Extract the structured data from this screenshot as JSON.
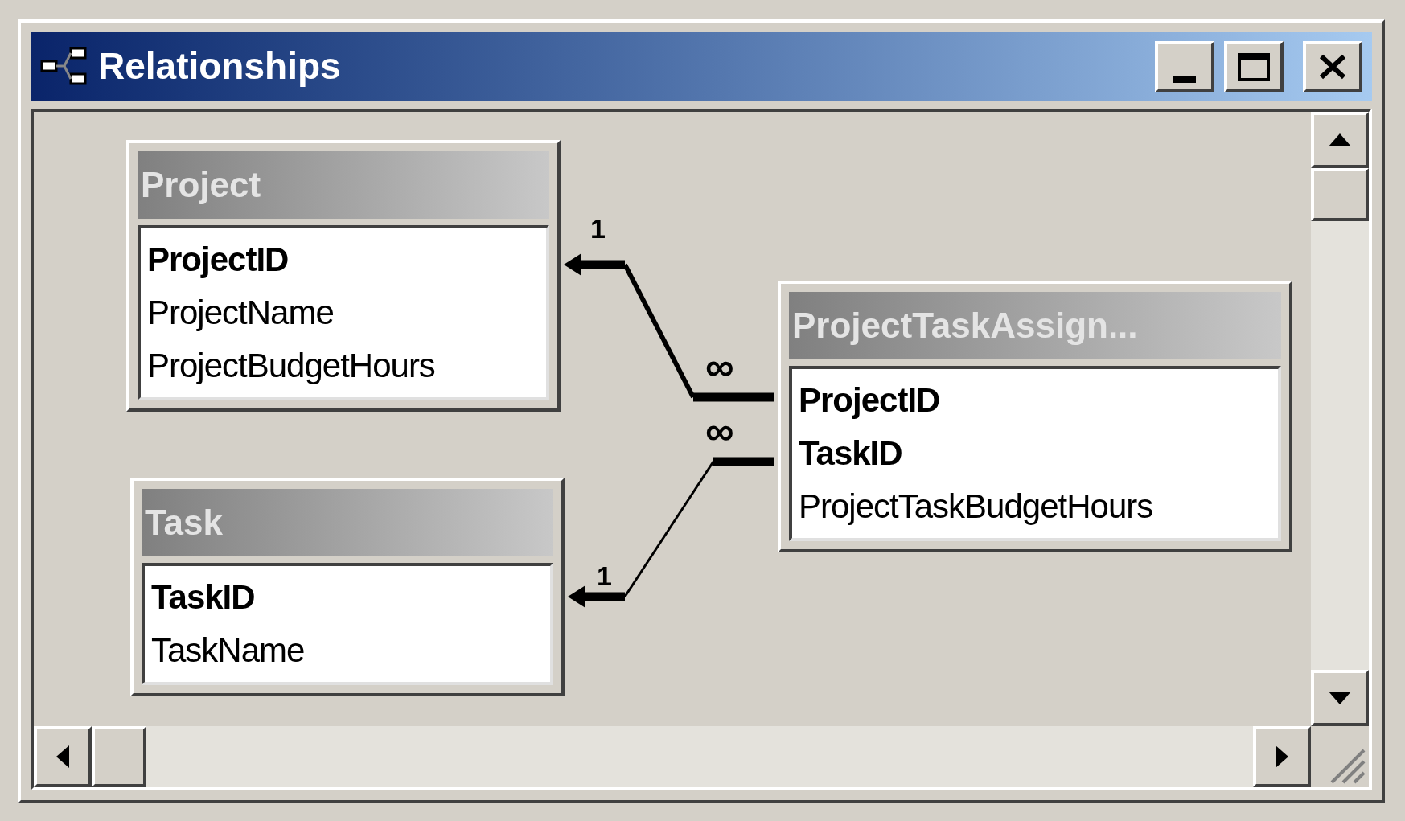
{
  "window": {
    "title": "Relationships"
  },
  "tables": [
    {
      "name": "Project",
      "fields": [
        {
          "name": "ProjectID",
          "key": true
        },
        {
          "name": "ProjectName",
          "key": false
        },
        {
          "name": "ProjectBudgetHours",
          "key": false
        }
      ]
    },
    {
      "name": "Task",
      "fields": [
        {
          "name": "TaskID",
          "key": true
        },
        {
          "name": "TaskName",
          "key": false
        }
      ]
    },
    {
      "name": "ProjectTaskAssign...",
      "fields": [
        {
          "name": "ProjectID",
          "key": true
        },
        {
          "name": "TaskID",
          "key": true
        },
        {
          "name": "ProjectTaskBudgetHours",
          "key": false
        }
      ]
    }
  ],
  "relationships": [
    {
      "one_label": "1",
      "many_label": "∞"
    },
    {
      "one_label": "1",
      "many_label": "∞"
    }
  ]
}
